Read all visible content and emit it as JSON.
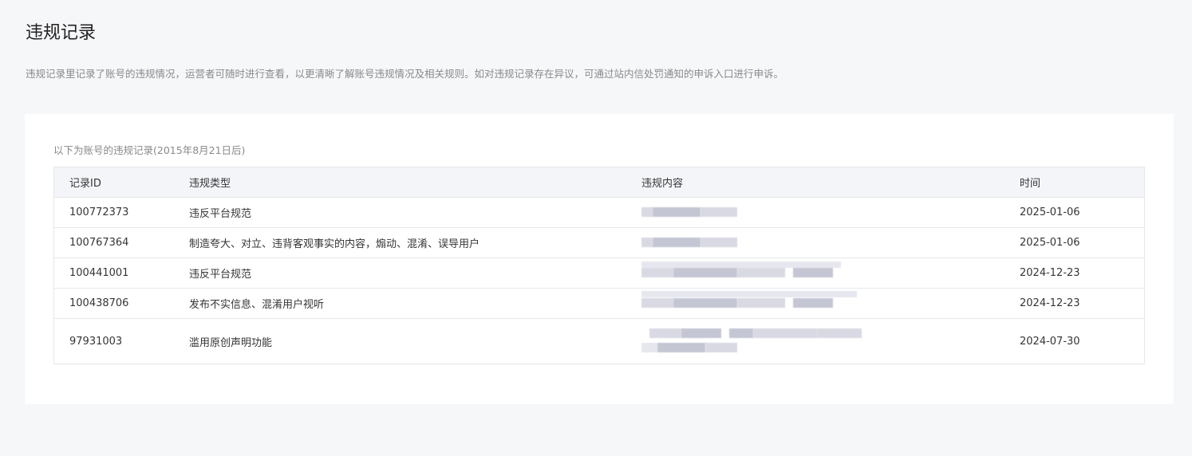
{
  "page": {
    "title": "违规记录",
    "description": "违规记录里记录了账号的违规情况，运营者可随时进行查看，以更清晰了解账号违规情况及相关规则。如对违规记录存在异议，可通过站内信处罚通知的申诉入口进行申诉。"
  },
  "card": {
    "subtitle": "以下为账号的违规记录(2015年8月21日后)"
  },
  "table": {
    "columns": [
      "记录ID",
      "违规类型",
      "违规内容",
      "时间"
    ],
    "rows": [
      {
        "id": "100772373",
        "type": "违反平台规范",
        "time": "2025-01-06"
      },
      {
        "id": "100767364",
        "type": "制造夸大、对立、违背客观事实的内容，煽动、混淆、误导用户",
        "time": "2025-01-06"
      },
      {
        "id": "100441001",
        "type": "违反平台规范",
        "time": "2024-12-23"
      },
      {
        "id": "100438706",
        "type": "发布不实信息、混淆用户视听",
        "time": "2024-12-23"
      },
      {
        "id": "97931003",
        "type": "滥用原创声明功能",
        "time": "2024-07-30"
      }
    ]
  }
}
